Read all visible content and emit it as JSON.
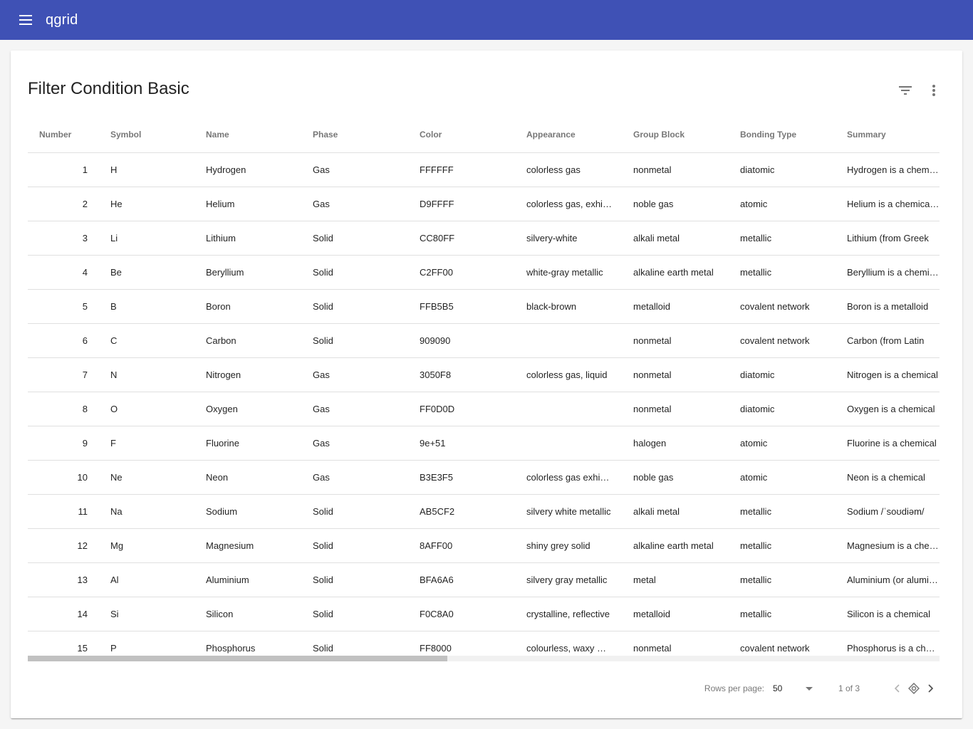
{
  "app": {
    "title": "qgrid"
  },
  "card": {
    "title": "Filter Condition Basic"
  },
  "columns": [
    "Number",
    "Symbol",
    "Name",
    "Phase",
    "Color",
    "Appearance",
    "Group Block",
    "Bonding Type",
    "Summary"
  ],
  "rows": [
    [
      "1",
      "H",
      "Hydrogen",
      "Gas",
      "FFFFFF",
      "colorless gas",
      "nonmetal",
      "diatomic",
      "Hydrogen is a chemical element"
    ],
    [
      "2",
      "He",
      "Helium",
      "Gas",
      "D9FFFF",
      "colorless gas, exhibiting",
      "noble gas",
      "atomic",
      "Helium is a chemical element"
    ],
    [
      "3",
      "Li",
      "Lithium",
      "Solid",
      "CC80FF",
      "silvery-white",
      "alkali metal",
      "metallic",
      "Lithium (from Greek"
    ],
    [
      "4",
      "Be",
      "Beryllium",
      "Solid",
      "C2FF00",
      "white-gray metallic",
      "alkaline earth metal",
      "metallic",
      "Beryllium is a chemical"
    ],
    [
      "5",
      "B",
      "Boron",
      "Solid",
      "FFB5B5",
      "black-brown",
      "metalloid",
      "covalent network",
      "Boron is a metalloid"
    ],
    [
      "6",
      "C",
      "Carbon",
      "Solid",
      "909090",
      "",
      "nonmetal",
      "covalent network",
      "Carbon (from Latin"
    ],
    [
      "7",
      "N",
      "Nitrogen",
      "Gas",
      "3050F8",
      "colorless gas, liquid",
      "nonmetal",
      "diatomic",
      "Nitrogen is a chemical"
    ],
    [
      "8",
      "O",
      "Oxygen",
      "Gas",
      "FF0D0D",
      "",
      "nonmetal",
      "diatomic",
      "Oxygen is a chemical"
    ],
    [
      "9",
      "F",
      "Fluorine",
      "Gas",
      "9e+51",
      "",
      "halogen",
      "atomic",
      "Fluorine is a chemical"
    ],
    [
      "10",
      "Ne",
      "Neon",
      "Gas",
      "B3E3F5",
      "colorless gas exhibiting",
      "noble gas",
      "atomic",
      "Neon is a chemical"
    ],
    [
      "11",
      "Na",
      "Sodium",
      "Solid",
      "AB5CF2",
      "silvery white metallic",
      "alkali metal",
      "metallic",
      "Sodium /ˈsoʊdiəm/"
    ],
    [
      "12",
      "Mg",
      "Magnesium",
      "Solid",
      "8AFF00",
      "shiny grey solid",
      "alkaline earth metal",
      "metallic",
      "Magnesium is a chemical"
    ],
    [
      "13",
      "Al",
      "Aluminium",
      "Solid",
      "BFA6A6",
      "silvery gray metallic",
      "metal",
      "metallic",
      "Aluminium (or aluminum"
    ],
    [
      "14",
      "Si",
      "Silicon",
      "Solid",
      "F0C8A0",
      "crystalline, reflective",
      "metalloid",
      "metallic",
      "Silicon is a chemical"
    ],
    [
      "15",
      "P",
      "Phosphorus",
      "Solid",
      "FF8000",
      "colourless, waxy white",
      "nonmetal",
      "covalent network",
      "Phosphorus is a chemical"
    ]
  ],
  "pager": {
    "rows_per_page_label": "Rows per page:",
    "rows_per_page_value": "50",
    "page_info": "1 of 3"
  },
  "colors": {
    "primary": "#3f51b5"
  },
  "icons": {
    "menu": "menu-icon",
    "filter": "filter-list-icon",
    "more": "more-vert-icon",
    "prev": "chevron-left-icon",
    "refresh": "focus-icon",
    "next": "chevron-right-icon",
    "dropdown": "arrow-drop-down-icon"
  }
}
